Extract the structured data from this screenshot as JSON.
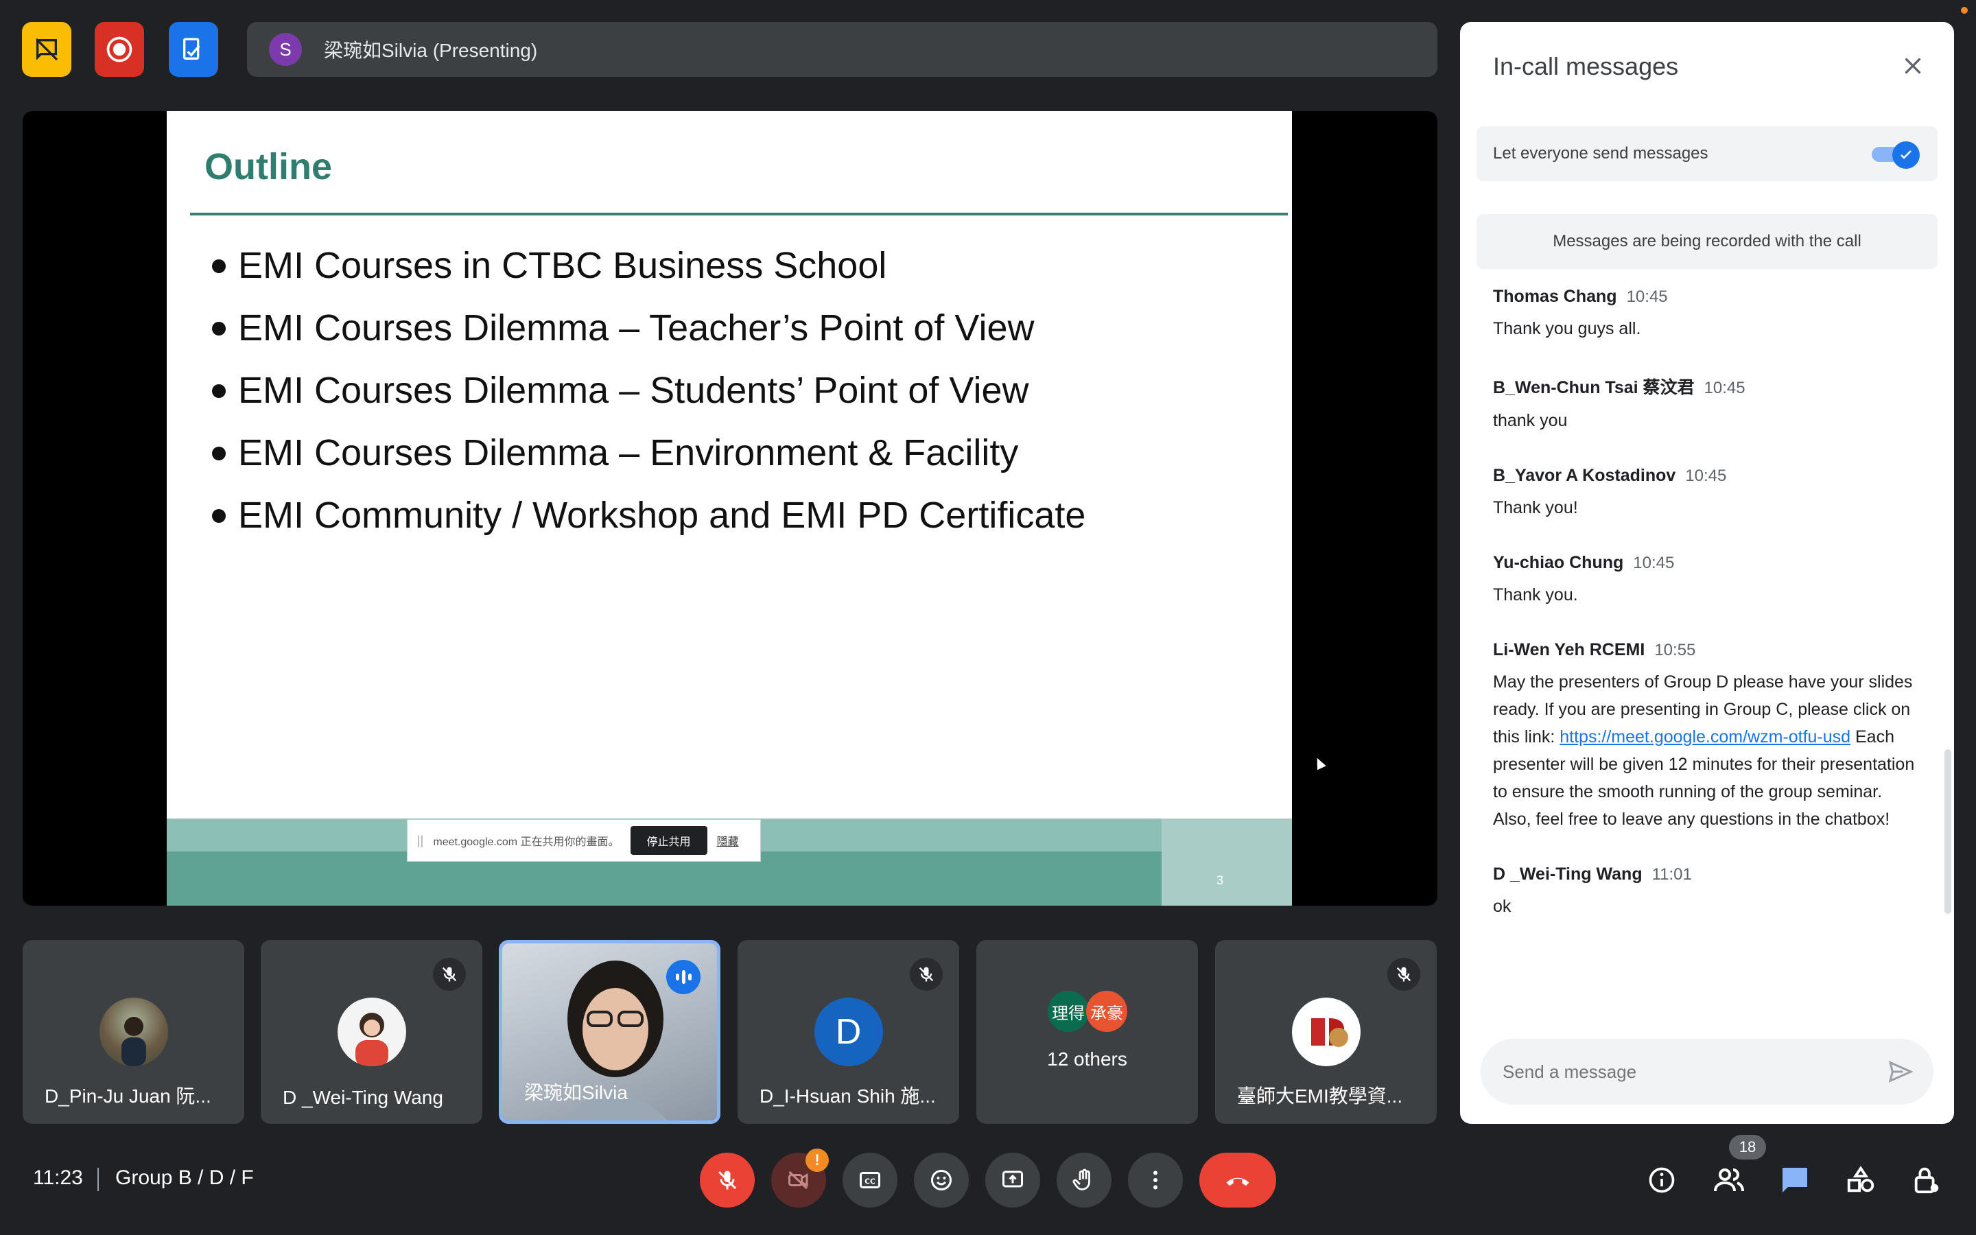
{
  "top_bar": {
    "presenter_initial": "S",
    "presenter_label": "梁琬如Silvia (Presenting)"
  },
  "slide": {
    "title": "Outline",
    "bullets": [
      "EMI Courses in CTBC Business School",
      "EMI Courses Dilemma – Teacher’s Point of View",
      "EMI Courses Dilemma – Students’ Point of View",
      "EMI Courses Dilemma – Environment & Facility",
      "EMI Community / Workshop and EMI PD Certificate"
    ],
    "page_number": "3",
    "share_banner": {
      "text": "meet.google.com 正在共用你的畫面。",
      "stop_label": "停止共用",
      "hide_label": "隱藏"
    }
  },
  "tiles": [
    {
      "name": "D_Pin-Ju Juan 阮..."
    },
    {
      "name": "D _Wei-Ting Wang"
    },
    {
      "name": "梁琬如Silvia"
    },
    {
      "name": "D_I-Hsuan Shih 施...",
      "initial": "D"
    },
    {
      "name": "12 others",
      "chip1": "理得",
      "chip2": "承豪"
    },
    {
      "name": "臺師大EMI教學資..."
    }
  ],
  "bottom_bar": {
    "time": "11:23",
    "meeting_name": "Group B / D / F",
    "people_count": "18"
  },
  "panel": {
    "title": "In-call messages",
    "toggle_label": "Let everyone send messages",
    "toggle_on": true,
    "record_note": "Messages are being recorded with the call",
    "messages": [
      {
        "sender": "Thomas Chang",
        "time": "10:45",
        "text": "Thank you guys all."
      },
      {
        "sender": "B_Wen-Chun Tsai 蔡汶君",
        "time": "10:45",
        "text": "thank you"
      },
      {
        "sender": "B_Yavor A Kostadinov",
        "time": "10:45",
        "text": "Thank you!"
      },
      {
        "sender": "Yu-chiao Chung",
        "time": "10:45",
        "text": "Thank you."
      },
      {
        "sender": "Li-Wen Yeh RCEMI",
        "time": "10:55",
        "text_before": "May the presenters of Group D please have your slides ready. If you are presenting in Group C, please click on this link: ",
        "link": "https://meet.google.com/wzm-otfu-usd",
        "text_after": "  Each presenter will be given 12 minutes for their presentation to ensure the smooth running of the group seminar. Also, feel free to leave any questions in the chatbox!"
      },
      {
        "sender": "D _Wei-Ting Wang",
        "time": "11:01",
        "text": "ok"
      }
    ],
    "input_placeholder": "Send a message"
  },
  "colors": {
    "background": "#202124",
    "tile": "#3c4043",
    "accent_blue": "#1a73e8",
    "danger_red": "#ea4335",
    "slide_teal": "#2f7d6f",
    "yellow_button": "#fbbc04"
  },
  "icons": {
    "top_left": [
      "no-chat-icon",
      "record-icon",
      "present-doc-icon"
    ],
    "bottom_center": [
      "mic-off-icon",
      "camera-off-icon",
      "captions-icon",
      "emoji-icon",
      "present-screen-icon",
      "raise-hand-icon",
      "more-icon",
      "hang-up-icon"
    ],
    "bottom_right": [
      "info-icon",
      "people-icon",
      "chat-icon",
      "activities-icon",
      "host-controls-icon"
    ]
  }
}
